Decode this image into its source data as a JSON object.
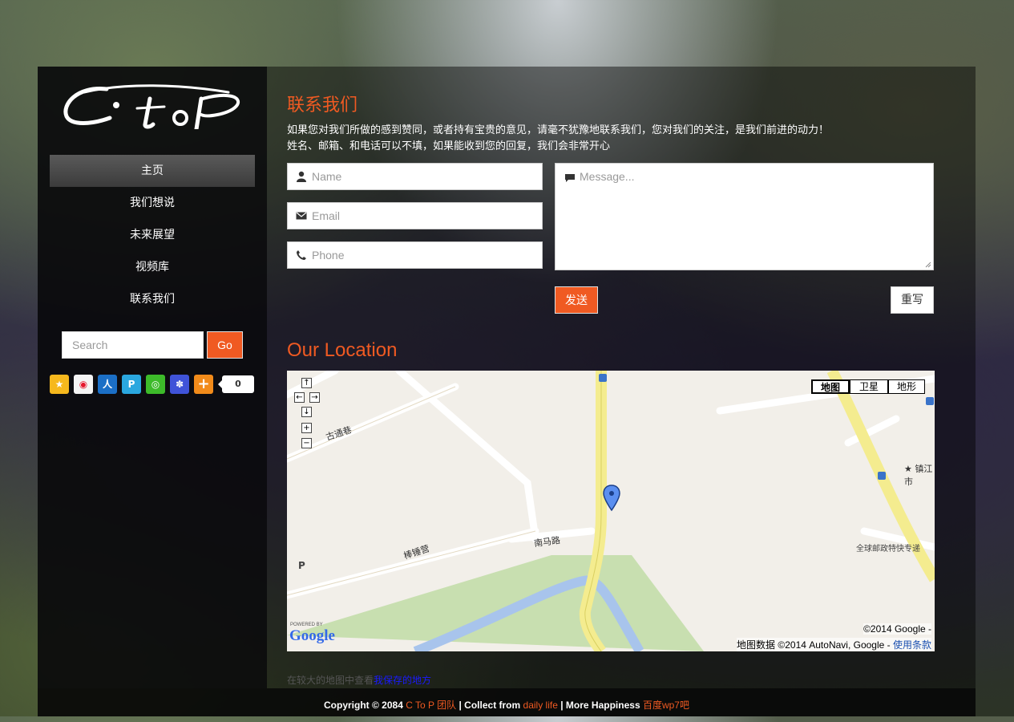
{
  "brand": {
    "logo_text": "C to P"
  },
  "nav": {
    "items": [
      {
        "label": "主页",
        "active": true
      },
      {
        "label": "我们想说"
      },
      {
        "label": "未来展望"
      },
      {
        "label": "视频库"
      },
      {
        "label": "联系我们"
      }
    ]
  },
  "search": {
    "placeholder": "Search",
    "button": "Go"
  },
  "share": {
    "icons": [
      "qzone-icon",
      "weibo-icon",
      "renren-icon",
      "pengyou-icon",
      "wechat-icon",
      "baidu-icon",
      "more-share-icon"
    ],
    "count": "0"
  },
  "contact": {
    "title": "联系我们",
    "intro_line1": "如果您对我们所做的感到赞同，或者持有宝贵的意见，请毫不犹豫地联系我们，您对我们的关注，是我们前进的动力！",
    "intro_line2": "姓名、邮箱、和电话可以不填，如果能收到您的回复，我们会非常开心",
    "name_placeholder": "Name",
    "email_placeholder": "Email",
    "phone_placeholder": "Phone",
    "message_placeholder": "Message...",
    "send": "发送",
    "reset": "重写"
  },
  "location": {
    "title": "Our Location",
    "map_types": [
      "地图",
      "卫星",
      "地形"
    ],
    "streets": [
      "古通巷",
      "南马路",
      "棒锤营"
    ],
    "poi_1": "镇江市",
    "poi_2": "全球邮政特快专递",
    "poi_3": "P",
    "copyright": "©2014 Google -",
    "map_data": "地图数据 ©2014 AutoNavi, Google -",
    "terms": "使用条款",
    "powered_by": "POWERED BY",
    "google": "Google",
    "view_larger_prefix": "在较大的地图中查看",
    "view_larger_link": "我保存的地方"
  },
  "footer": {
    "copyright": "Copyright © 2084",
    "team": "C To P 团队",
    "collect": "| Collect from",
    "daily": "daily life",
    "more": "| More Happiness",
    "baidu": "百度wp7吧"
  },
  "colors": {
    "accent": "#f05a22",
    "sidebar_bg": "#0e0e10",
    "nav_active": "#4a4a4a"
  }
}
